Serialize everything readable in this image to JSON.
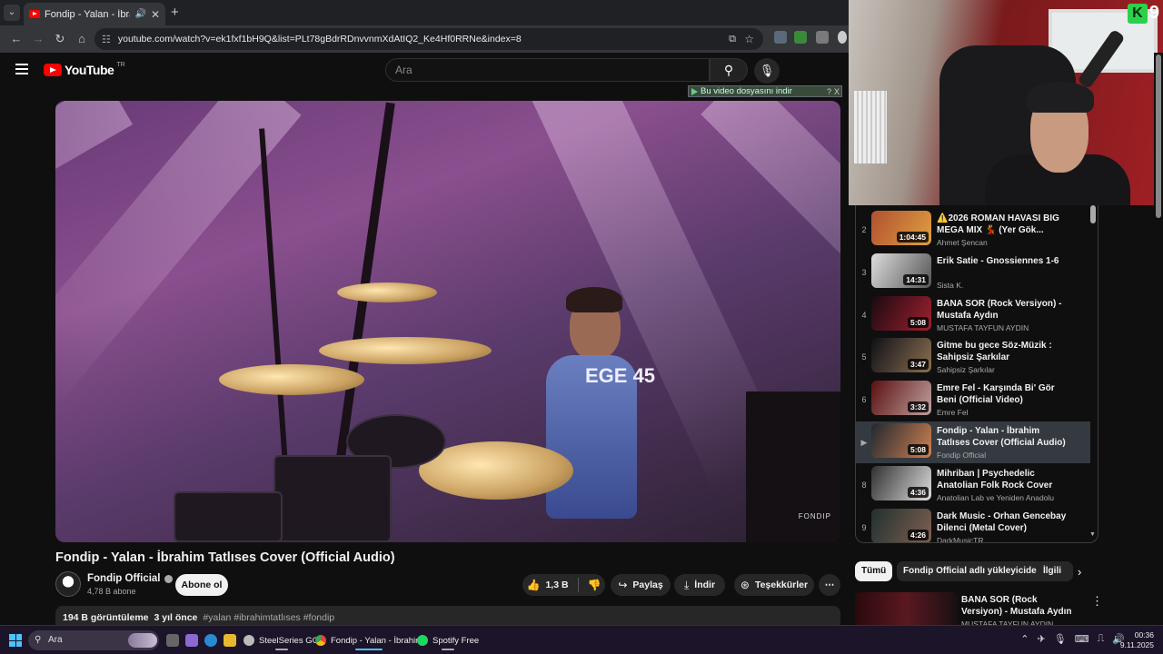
{
  "browser": {
    "tab_title": "Fondip - Yalan - İbrahim Tatl",
    "url": "youtube.com/watch?v=ek1fxf1bH9Q&list=PLt78gBdrRDnvvnmXdAtIQ2_Ke4Hf0RRNe&index=8"
  },
  "youtube": {
    "logo_text": "YouTube",
    "country_code": "TR",
    "search_placeholder": "Ara"
  },
  "download_bar": {
    "label": "Bu video dosyasını indir",
    "help": "?",
    "close": "X"
  },
  "video": {
    "watermark": "FONDIP",
    "jersey_text": "EGE 45",
    "title": "Fondip - Yalan - İbrahim Tatlıses Cover (Official Audio)",
    "channel": "Fondip Official",
    "subscribers": "4,78 B abone",
    "subscribe_label": "Abone ol",
    "likes": "1,3 B",
    "share_label": "Paylaş",
    "download_label": "İndir",
    "thanks_label": "Teşekkürler",
    "more_label": "⋯",
    "views": "194 B görüntüleme",
    "age": "3 yıl önce",
    "tags": "#yalan #ibrahimtatlıses #fondip"
  },
  "webcam": {
    "overlay_digit": "9",
    "overlay_letter": "K"
  },
  "playlist": [
    {
      "index": "2",
      "title": "⚠️2026 ROMAN HAVASI BIG MEGA MIX 💃 (Yer Gök...",
      "channel": "Ahmet Şencan",
      "duration": "1:04:45",
      "colors": [
        "#b05030",
        "#e0a040"
      ]
    },
    {
      "index": "3",
      "title": "Erik Satie - Gnossiennes 1-6",
      "channel": "Sista K.",
      "duration": "14:31",
      "colors": [
        "#ddd",
        "#555"
      ]
    },
    {
      "index": "4",
      "title": "BANA SOR (Rock Versiyon) - Mustafa Aydın",
      "channel": "MUSTAFA TAYFUN AYDIN",
      "duration": "5:08",
      "colors": [
        "#1a0a10",
        "#a02030"
      ]
    },
    {
      "index": "5",
      "title": "Gitme bu gece Söz-Müzik : Sahipsiz Şarkılar",
      "channel": "Sahipsiz Şarkılar",
      "duration": "3:47",
      "colors": [
        "#101018",
        "#8a7050"
      ]
    },
    {
      "index": "6",
      "title": "Emre Fel - Karşında Bi' Gör Beni (Official Video)",
      "channel": "Emre Fel",
      "duration": "3:32",
      "colors": [
        "#5a1010",
        "#c0a0a0"
      ]
    },
    {
      "index": "▶",
      "title": "Fondip - Yalan - İbrahim Tatlıses Cover (Official Audio)",
      "channel": "Fondip Official",
      "duration": "5:08",
      "colors": [
        "#202830",
        "#d08050"
      ],
      "active": true
    },
    {
      "index": "8",
      "title": "Mihriban | Psychedelic Anatolian Folk Rock Cover",
      "channel": "Anatolian Lab ve Yeniden Anadolu",
      "duration": "4:36",
      "colors": [
        "#303030",
        "#ddd"
      ]
    },
    {
      "index": "9",
      "title": "Dark Music - Orhan Gencebay Dilenci (Metal Cover)",
      "channel": "DarkMusicTR",
      "duration": "4:26",
      "colors": [
        "#203030",
        "#806050"
      ]
    }
  ],
  "chips": [
    "Tümü",
    "Fondip Official adlı yükleyiciden",
    "İlgili"
  ],
  "recommendation": {
    "title": "BANA SOR (Rock Versiyon) - Mustafa Aydın",
    "channel": "MUSTAFA TAYFUN AYDIN"
  },
  "taskbar": {
    "search_label": "Ara",
    "apps": [
      "SteelSeries GG",
      "Fondip - Yalan - İbrahim",
      "Spotify Free"
    ],
    "time": "00:36",
    "date": "9.11.2025"
  },
  "colors": {
    "youtube_red": "#ff0000",
    "active_row": "#343a40",
    "taskbar": "#1c1428"
  }
}
